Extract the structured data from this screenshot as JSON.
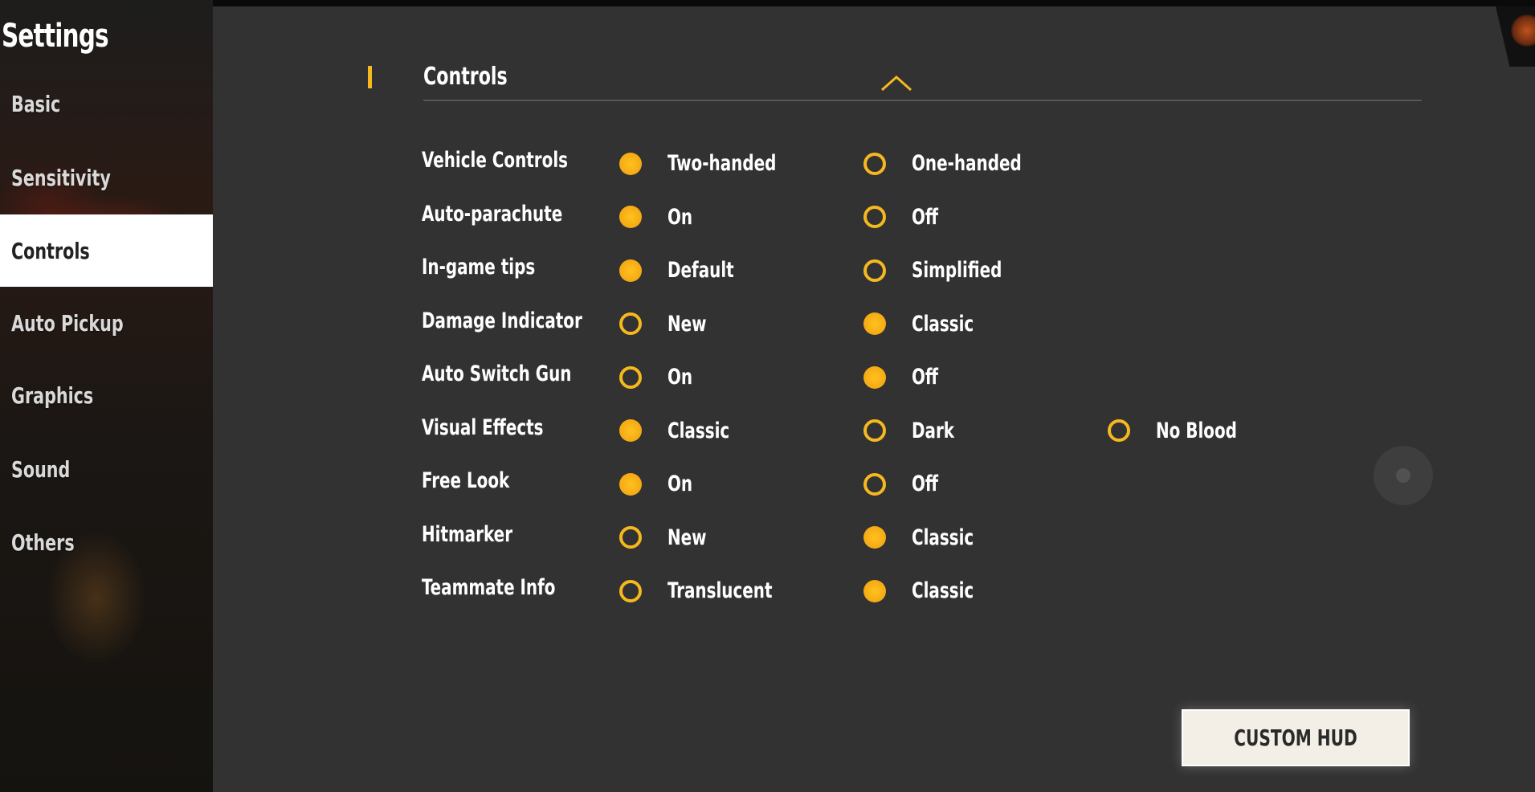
{
  "sidebar": {
    "title": "Settings",
    "items": [
      {
        "label": "Basic",
        "active": false
      },
      {
        "label": "Sensitivity",
        "active": false
      },
      {
        "label": "Controls",
        "active": true
      },
      {
        "label": "Auto Pickup",
        "active": false
      },
      {
        "label": "Graphics",
        "active": false
      },
      {
        "label": "Sound",
        "active": false
      },
      {
        "label": "Others",
        "active": false
      }
    ]
  },
  "section": {
    "title": "Controls",
    "collapse_icon": "chevron-up-icon"
  },
  "settings": [
    {
      "label": "Vehicle Controls",
      "options": [
        {
          "label": "Two-handed",
          "selected": true
        },
        {
          "label": "One-handed",
          "selected": false
        }
      ]
    },
    {
      "label": "Auto-parachute",
      "options": [
        {
          "label": "On",
          "selected": true
        },
        {
          "label": "Off",
          "selected": false
        }
      ]
    },
    {
      "label": "In-game tips",
      "options": [
        {
          "label": "Default",
          "selected": true
        },
        {
          "label": "Simplified",
          "selected": false
        }
      ]
    },
    {
      "label": "Damage Indicator",
      "options": [
        {
          "label": "New",
          "selected": false
        },
        {
          "label": "Classic",
          "selected": true
        }
      ]
    },
    {
      "label": "Auto Switch Gun",
      "options": [
        {
          "label": "On",
          "selected": false
        },
        {
          "label": "Off",
          "selected": true
        }
      ]
    },
    {
      "label": "Visual Effects",
      "options": [
        {
          "label": "Classic",
          "selected": true
        },
        {
          "label": "Dark",
          "selected": false
        },
        {
          "label": "No Blood",
          "selected": false
        }
      ]
    },
    {
      "label": "Free Look",
      "options": [
        {
          "label": "On",
          "selected": true
        },
        {
          "label": "Off",
          "selected": false
        }
      ]
    },
    {
      "label": "Hitmarker",
      "options": [
        {
          "label": "New",
          "selected": false
        },
        {
          "label": "Classic",
          "selected": true
        }
      ]
    },
    {
      "label": "Teammate Info",
      "options": [
        {
          "label": "Translucent",
          "selected": false
        },
        {
          "label": "Classic",
          "selected": true
        }
      ]
    }
  ],
  "custom_hud_label": "CUSTOM HUD",
  "colors": {
    "accent": "#f5b81f",
    "panel": "#323232",
    "active_tab": "#ffffff"
  }
}
